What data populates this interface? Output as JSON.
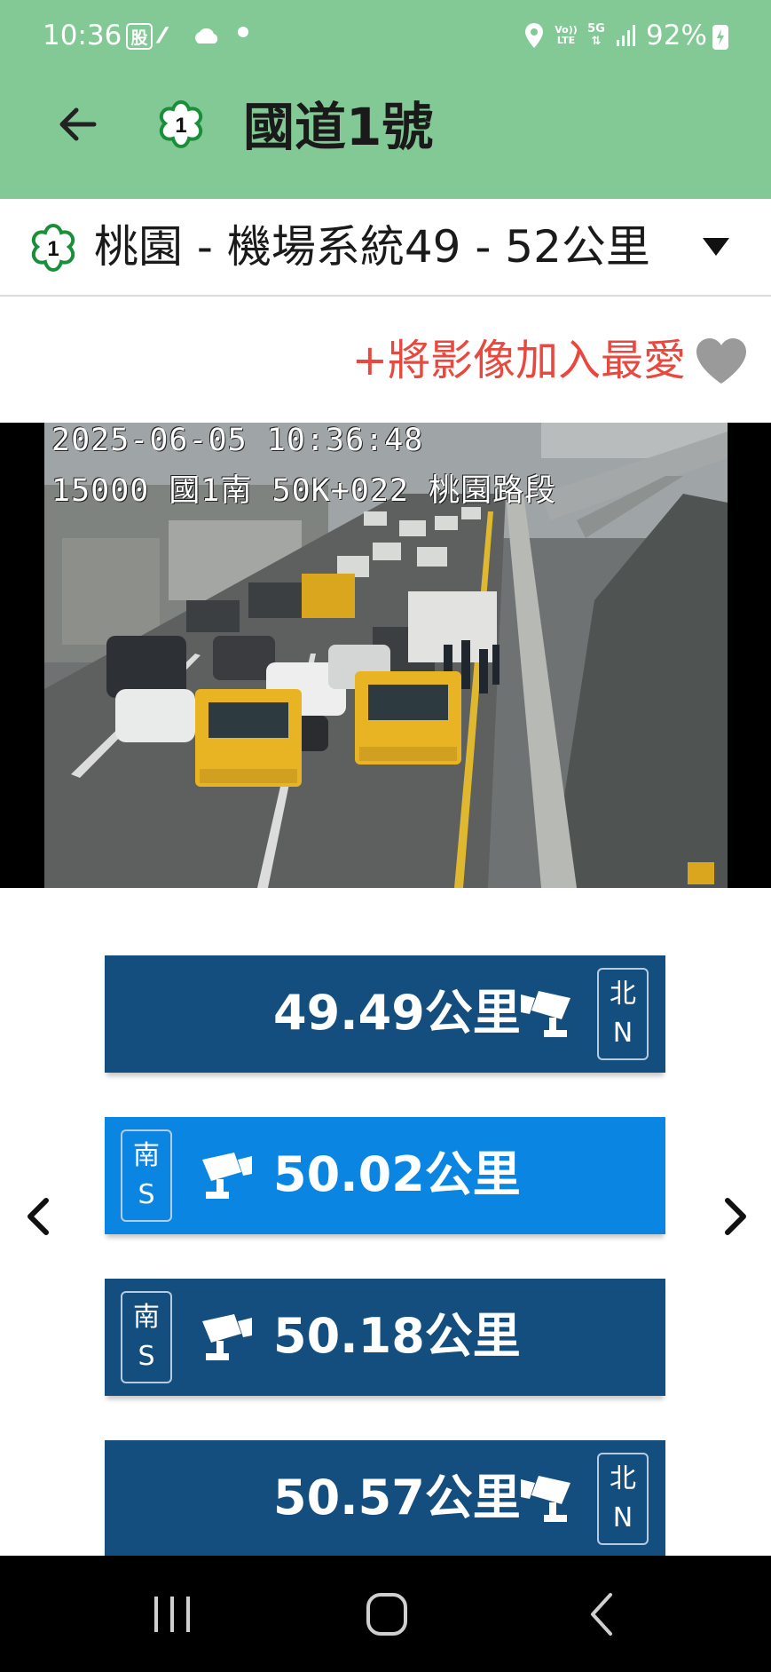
{
  "status_bar": {
    "time": "10:36",
    "stock_icon_text": "股",
    "volte_line1": "Vo))",
    "volte_line2": "LTE",
    "network": "5G",
    "battery": "92%"
  },
  "app_bar": {
    "title": "國道1號",
    "logo_number": "1",
    "back_icon": "arrow-left-icon"
  },
  "segment": {
    "logo_number": "1",
    "label": "桃園 - 機場系統49 - 52公里"
  },
  "favorite": {
    "label": "+將影像加入最愛"
  },
  "camera": {
    "timestamp": "2025-06-05 10:36:48",
    "info": "15000 國1南 50K+022 桃園路段"
  },
  "camera_list": [
    {
      "km": "49.49公里",
      "dir_zh": "北",
      "dir_en": "N",
      "layout": "north",
      "selected": false
    },
    {
      "km": "50.02公里",
      "dir_zh": "南",
      "dir_en": "S",
      "layout": "south",
      "selected": true
    },
    {
      "km": "50.18公里",
      "dir_zh": "南",
      "dir_en": "S",
      "layout": "south",
      "selected": false
    },
    {
      "km": "50.57公里",
      "dir_zh": "北",
      "dir_en": "N",
      "layout": "north",
      "selected": false
    }
  ],
  "colors": {
    "app_bar": "#82c995",
    "camera_button": "#134e7e",
    "camera_button_selected": "#0a86e2",
    "favorite_text": "#e8483e"
  }
}
